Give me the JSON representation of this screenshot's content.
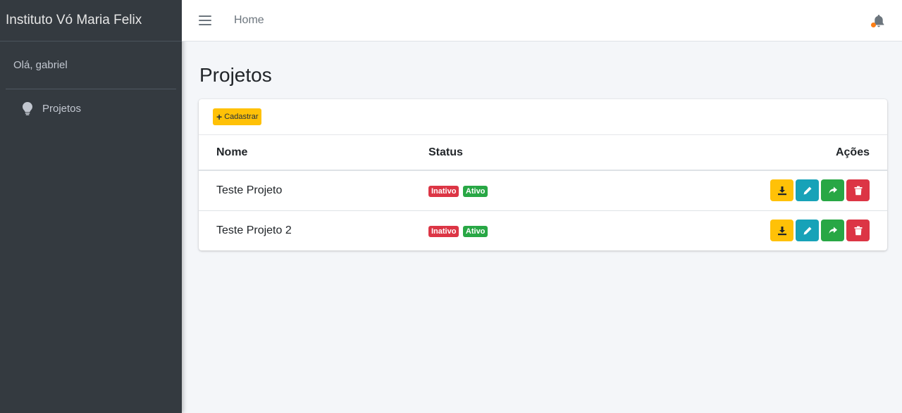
{
  "sidebar": {
    "brand": "Instituto Vó Maria Felix",
    "greeting": "Olá, gabriel",
    "items": [
      {
        "label": "Projetos",
        "icon": "lightbulb-icon"
      }
    ]
  },
  "topbar": {
    "home_label": "Home",
    "notification_dot_color": "#fd7e14"
  },
  "main": {
    "title": "Projetos",
    "add_button_label": "Cadastrar",
    "table": {
      "headers": {
        "nome": "Nome",
        "status": "Status",
        "acoes": "Ações"
      },
      "rows": [
        {
          "nome": "Teste Projeto",
          "badges": [
            "Inativo",
            "Ativo"
          ]
        },
        {
          "nome": "Teste Projeto 2",
          "badges": [
            "Inativo",
            "Ativo"
          ]
        }
      ]
    }
  },
  "colors": {
    "sidebar_bg": "#343a40",
    "warning": "#ffc107",
    "info": "#17a2b8",
    "success": "#28a745",
    "danger": "#dc3545"
  }
}
